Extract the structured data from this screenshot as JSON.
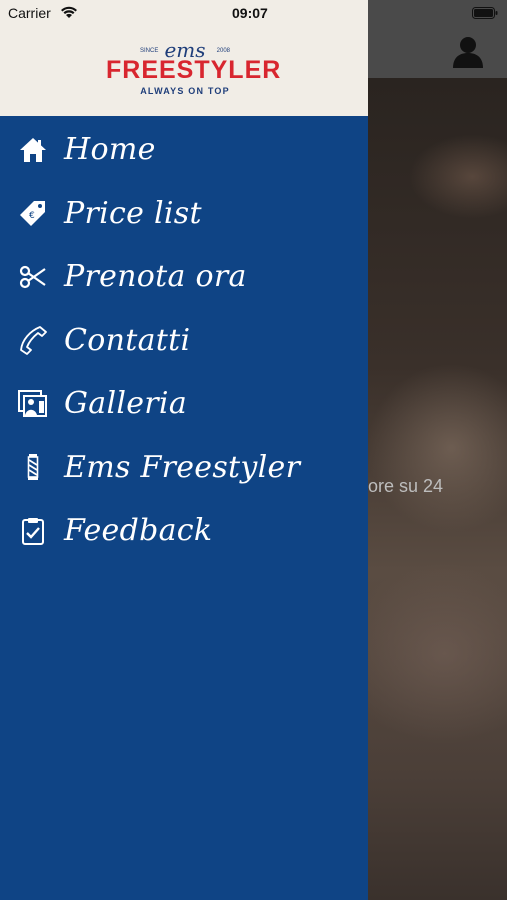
{
  "status_bar": {
    "carrier": "Carrier",
    "time": "09:07"
  },
  "drawer": {
    "logo": {
      "script": "ems",
      "since": "SINCE",
      "year": "2008",
      "brand": "FREESTYLER",
      "tagline": "ALWAYS ON TOP"
    },
    "items": [
      {
        "label": "Home",
        "icon": "home-icon"
      },
      {
        "label": "Price list",
        "icon": "price-tag-icon"
      },
      {
        "label": "Prenota ora",
        "icon": "scissors-icon"
      },
      {
        "label": "Contatti",
        "icon": "phone-icon"
      },
      {
        "label": "Galleria",
        "icon": "gallery-icon"
      },
      {
        "label": "Ems Freestyler",
        "icon": "barber-pole-icon"
      },
      {
        "label": "Feedback",
        "icon": "clipboard-check-icon"
      }
    ]
  },
  "background": {
    "overlay_text": "ore su 24",
    "profile_icon": "user-icon"
  },
  "colors": {
    "drawer_bg": "#0f4485",
    "header_bg": "#f1ede6",
    "brand_red": "#d8262f",
    "brand_blue": "#1f3e7a"
  }
}
